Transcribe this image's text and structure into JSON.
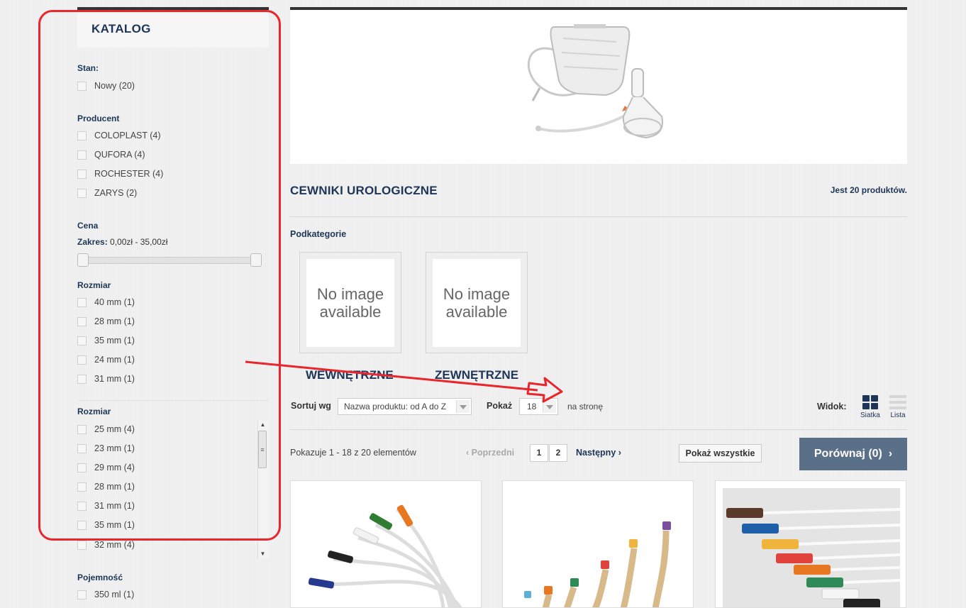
{
  "sidebar": {
    "title": "KATALOG",
    "groups": [
      {
        "title": "Stan:",
        "items": [
          "Nowy (20)"
        ]
      },
      {
        "title": "Producent",
        "items": [
          "COLOPLAST (4)",
          "QUFORA (4)",
          "ROCHESTER (4)",
          "ZARYS (2)"
        ]
      },
      {
        "title": "Cena"
      },
      {
        "title": "Rozmiar",
        "items": [
          "40 mm (1)",
          "28 mm (1)",
          "35 mm (1)",
          "24 mm (1)",
          "31 mm (1)"
        ]
      },
      {
        "title": "Rozmiar",
        "items": [
          "25 mm (4)",
          "23 mm (1)",
          "29 mm (4)",
          "28 mm (1)",
          "31 mm (1)",
          "35 mm (1)",
          "32 mm (4)"
        ]
      },
      {
        "title": "Pojemność",
        "items": [
          "350 ml (1)"
        ]
      }
    ],
    "price": {
      "label": "Zakres:",
      "value": "0,00zł - 35,00zł",
      "min_fraction": 0,
      "max_fraction": 1
    }
  },
  "category": {
    "title": "CEWNIKI UROLOGICZNE",
    "count": "Jest 20 produktów.",
    "subcategories_heading": "Podkategorie",
    "subcategories": [
      {
        "name": "WEWNĘTRZNE",
        "image_text": "No image available"
      },
      {
        "name": "ZEWNĘTRZNE",
        "image_text": "No image available"
      }
    ]
  },
  "toolbar": {
    "sort_label": "Sortuj wg",
    "sort_value": "Nazwa produktu: od A do Z",
    "show_label": "Pokaż",
    "show_value": "18",
    "per_page": "na stronę",
    "view_label": "Widok:",
    "view_grid": "Siatka",
    "view_list": "Lista"
  },
  "pagination": {
    "showing": "Pokazuje 1 - 18 z 20 elementów",
    "prev": "Poprzedni",
    "pages": [
      "1",
      "2"
    ],
    "next": "Następny",
    "show_all": "Pokaż wszystkie",
    "compare": "Porównaj (0)"
  },
  "colors": {
    "brand": "#1d3557",
    "annotation": "#e8262c",
    "compare_bg": "#5a6f88"
  }
}
